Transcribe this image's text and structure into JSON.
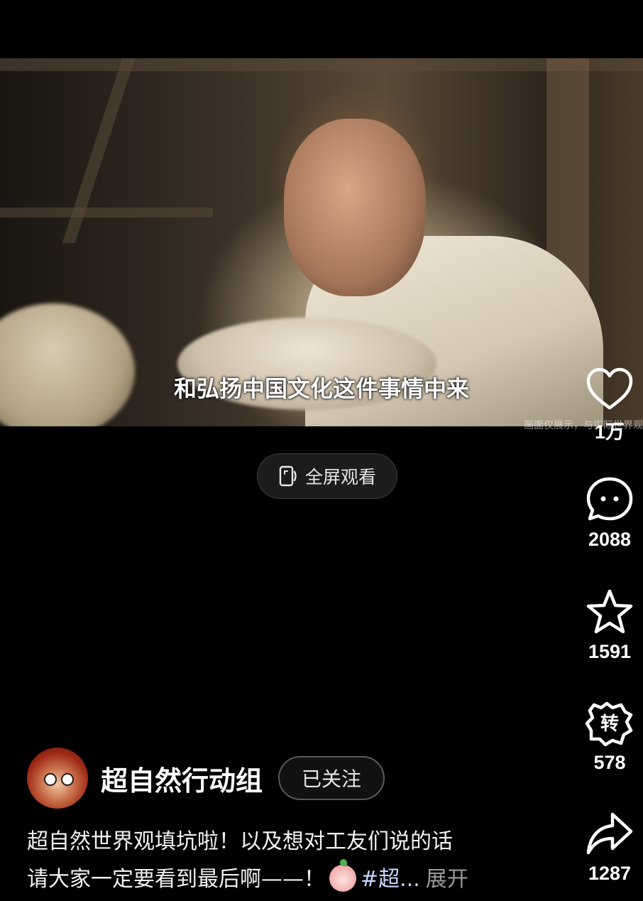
{
  "video": {
    "subtitle": "和弘扬中国文化这件事情中来",
    "watermark": "画面仅展示，与实际世界观"
  },
  "fullscreen_button": {
    "label": "全屏观看",
    "icon": "fullscreen-phone-icon"
  },
  "actions": {
    "like": {
      "icon": "heart-icon",
      "count": "1万"
    },
    "comment": {
      "icon": "comment-icon",
      "count": "2088"
    },
    "favorite": {
      "icon": "star-icon",
      "count": "1591"
    },
    "repost": {
      "icon": "repost-icon",
      "count": "578"
    },
    "share": {
      "icon": "share-arrow-icon",
      "count": "1287"
    }
  },
  "author": {
    "name": "超自然行动组",
    "follow_label": "已关注"
  },
  "description": {
    "line1": "超自然世界观填坑啦！以及想对工友们说的话",
    "line2_text": "请大家一定要看到最后啊——！",
    "hashtag": "#超...",
    "expand_label": "展开"
  },
  "colors": {
    "background": "#000000",
    "hashtag": "#c9d8ff",
    "muted": "#9a9a9a"
  }
}
